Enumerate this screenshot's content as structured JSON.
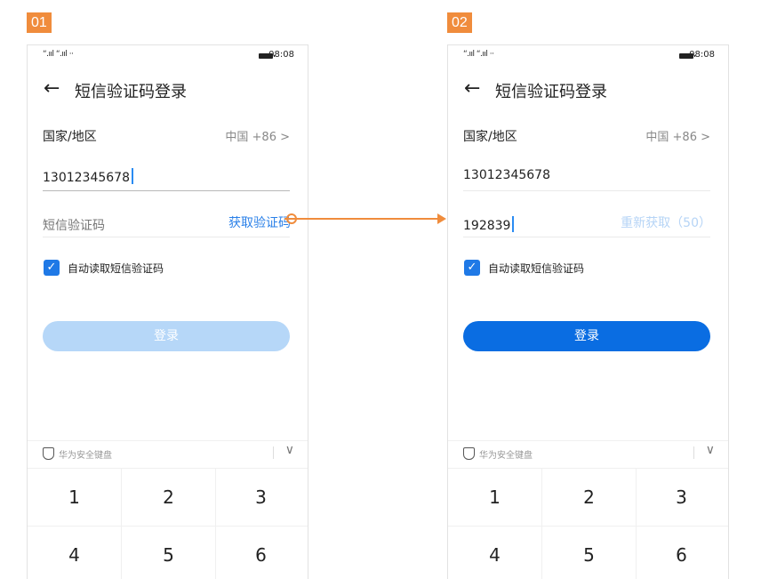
{
  "screens": [
    {
      "step": "01",
      "statusbar": {
        "signal": "“.ııl “.ııl ‧·",
        "time": "08:08"
      },
      "title": "短信验证码登录",
      "country_label": "国家/地区",
      "country_value": "中国 +86 >",
      "phone_number": "13012345678",
      "code_text": "短信验证码",
      "code_action": "获取验证码",
      "auto_read_label": "自动读取短信验证码",
      "login_label": "登录",
      "keyboard_title": "华为安全键盘",
      "keys": [
        "1",
        "2",
        "3",
        "4",
        "5",
        "6"
      ]
    },
    {
      "step": "02",
      "statusbar": {
        "signal": "“.ııl “.ııl ‧·",
        "time": "08:08"
      },
      "title": "短信验证码登录",
      "country_label": "国家/地区",
      "country_value": "中国 +86 >",
      "phone_number": "13012345678",
      "code_text": "192839",
      "code_action": "重新获取（50）",
      "auto_read_label": "自动读取短信验证码",
      "login_label": "登录",
      "keyboard_title": "华为安全键盘",
      "keys": [
        "1",
        "2",
        "3",
        "4",
        "5",
        "6"
      ]
    }
  ],
  "colors": {
    "accent": "#0a6de2",
    "accent_disabled": "#b6d7f8",
    "step_badge": "#f08c3c"
  }
}
